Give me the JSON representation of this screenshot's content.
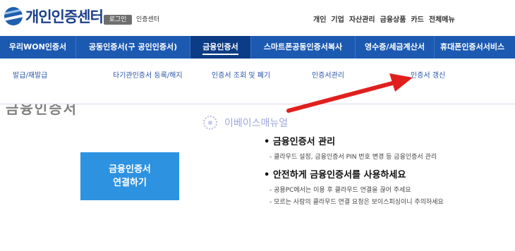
{
  "header": {
    "logo_text": "개인인증센터",
    "login_label": "로그인",
    "login_sublabel": "인증센터",
    "top_menu": [
      "개인",
      "기업",
      "자산관리",
      "금융상품",
      "카드",
      "전체메뉴"
    ]
  },
  "nav": {
    "items": [
      {
        "label": "우리WON인증서"
      },
      {
        "label": "공동인증서(구 공인인증서)"
      },
      {
        "label": "금융인증서"
      },
      {
        "label": "스마트폰공동인증서복사"
      },
      {
        "label": "영수증/세금계산서"
      },
      {
        "label": "휴대폰인증서서비스"
      }
    ],
    "active_index": 2
  },
  "submenu": {
    "items": [
      {
        "label": "발급/재발급"
      },
      {
        "label": "타기관인증서 등록/해지"
      },
      {
        "label": "인증서 조회 및 폐기"
      },
      {
        "label": "인증서관리"
      },
      {
        "label": "인증서 갱신"
      }
    ]
  },
  "page": {
    "title_partial": "금융인증서",
    "watermark": "이베이스매뉴얼",
    "connect_button": {
      "line1": "금융인증서",
      "line2": "연결하기"
    }
  },
  "info": {
    "section1": {
      "heading": "금융인증서 관리",
      "lines": [
        "- 클라우드 설정, 금융인증서 PIN 번호 변경 등 금융인증서 관리"
      ]
    },
    "section2": {
      "heading": "안전하게 금융인증서를 사용하세요",
      "lines": [
        "- 공용PC에서는 이용 후 클라우드 연결을 끊어 주세요",
        "- 모르는 사람의 클라우드 연결 요청은 보이스피싱이니 주의하세요"
      ]
    }
  },
  "colors": {
    "nav_bg": "#1c5ab2",
    "nav_active": "#0c3c86",
    "button_bg": "#2d92e0",
    "arrow": "#e0201e"
  }
}
